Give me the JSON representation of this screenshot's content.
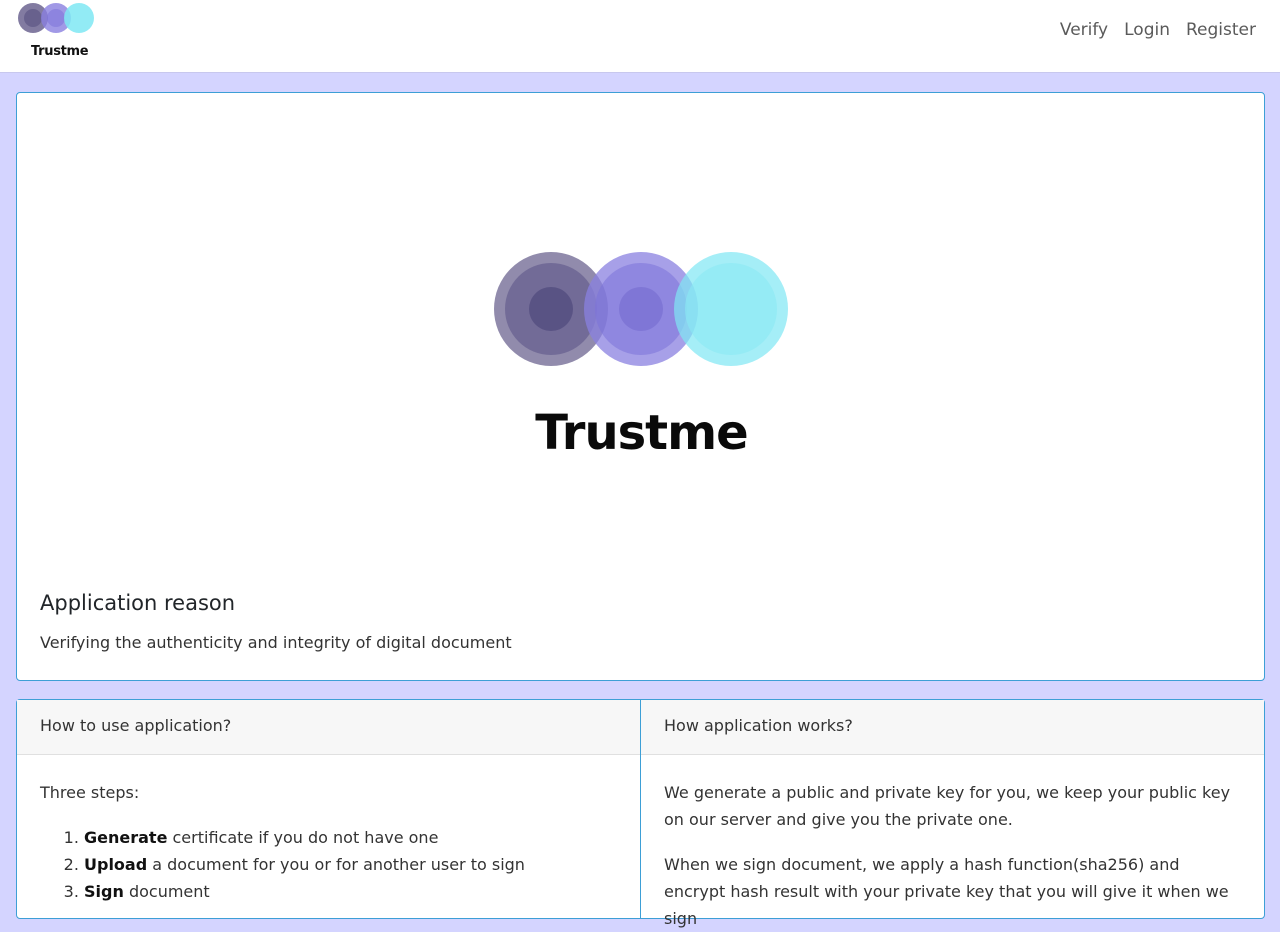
{
  "brand": {
    "name": "Trustme",
    "colors": [
      "#6c6490",
      "#8a80e0",
      "#7fe7f3"
    ]
  },
  "nav": {
    "items": [
      {
        "label": "Verify"
      },
      {
        "label": "Login"
      },
      {
        "label": "Register"
      }
    ]
  },
  "hero": {
    "logo_text": "Trustme",
    "title": "Application reason",
    "text": "Verifying the authenticity and integrity of digital document"
  },
  "how_to_use": {
    "header": "How to use application?",
    "intro": "Three steps:",
    "steps": [
      {
        "bold": "Generate",
        "rest": " certificate if you do not have one"
      },
      {
        "bold": "Upload",
        "rest": " a document for you or for another user to sign"
      },
      {
        "bold": "Sign",
        "rest": " document"
      }
    ]
  },
  "how_it_works": {
    "header": "How application works?",
    "paragraphs": [
      "We generate a public and private key for you, we keep your public key on our server and give you the private one.",
      "When we sign document, we apply a hash function(sha256) and encrypt hash result with your private key that you will give it when we sign"
    ]
  },
  "colors": {
    "page_bg": "#d4d4ff",
    "card_border": "#3d9fd6"
  }
}
